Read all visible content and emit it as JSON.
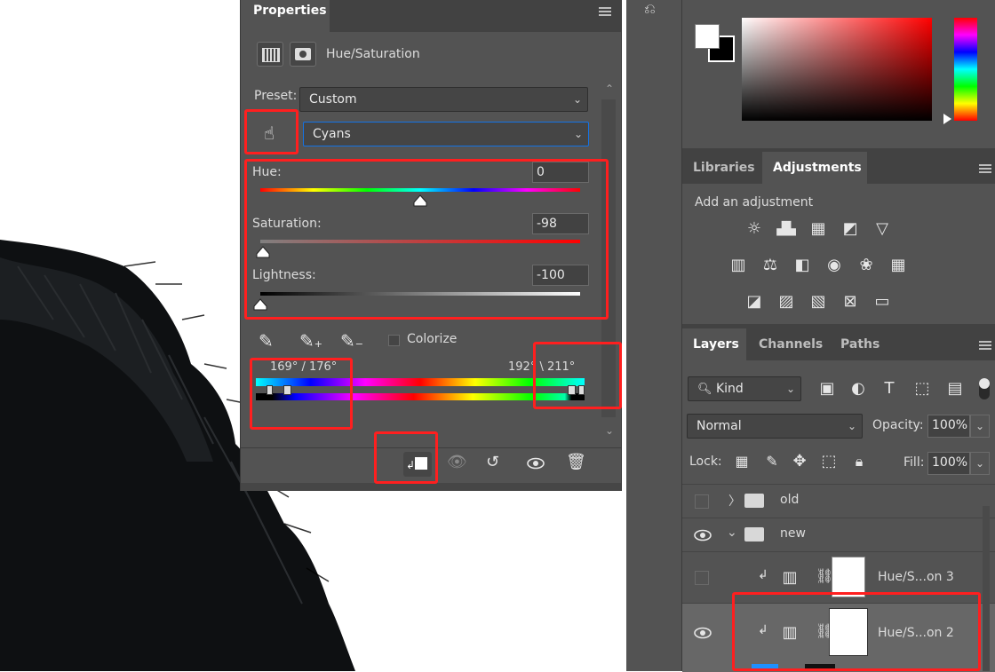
{
  "properties": {
    "tab_label": "Properties",
    "adjustment_title": "Hue/Saturation",
    "preset_label": "Preset:",
    "preset_value": "Custom",
    "channel_value": "Cyans",
    "hue_label": "Hue:",
    "hue_value": "0",
    "saturation_label": "Saturation:",
    "saturation_value": "-98",
    "lightness_label": "Lightness:",
    "lightness_value": "-100",
    "colorize_label": "Colorize",
    "range_left": "169° / 176°",
    "range_right": "192° \\ 211°"
  },
  "adjustments_panel": {
    "tabs": [
      "Libraries",
      "Adjustments"
    ],
    "active_tab": "Adjustments",
    "add_label": "Add an adjustment",
    "icons_row1": [
      "brightness-contrast-icon",
      "levels-icon",
      "curves-icon",
      "exposure-icon",
      "vibrance-icon"
    ],
    "icons_row2": [
      "hue-saturation-icon",
      "color-balance-icon",
      "black-white-icon",
      "photo-filter-icon",
      "channel-mixer-icon",
      "color-lookup-icon"
    ],
    "icons_row3": [
      "invert-icon",
      "posterize-icon",
      "threshold-icon",
      "selective-color-icon",
      "gradient-map-icon"
    ]
  },
  "layers_panel": {
    "tabs": [
      "Layers",
      "Channels",
      "Paths"
    ],
    "active_tab": "Layers",
    "filter_label": "Kind",
    "blend_mode": "Normal",
    "opacity_label": "Opacity:",
    "opacity_value": "100%",
    "lock_label": "Lock:",
    "fill_label": "Fill:",
    "fill_value": "100%",
    "layers": [
      {
        "name": "old",
        "visible": false
      },
      {
        "name": "new",
        "visible": true
      },
      {
        "name": "Hue/S...on 3",
        "visible": false
      },
      {
        "name": "Hue/S...on 2",
        "visible": true
      }
    ]
  },
  "colors": {
    "highlight": "#ff1f1f",
    "panel": "#535353",
    "panel_dark": "#424242"
  }
}
